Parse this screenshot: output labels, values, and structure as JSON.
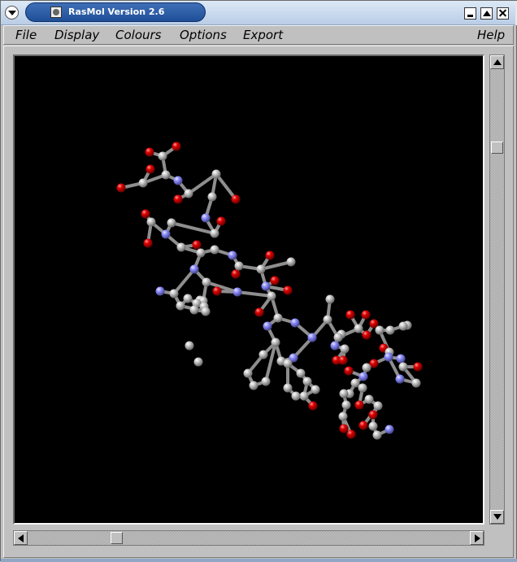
{
  "window": {
    "title": "RasMol Version 2.6"
  },
  "menu": {
    "file": "File",
    "display": "Display",
    "colours": "Colours",
    "options": "Options",
    "export": "Export",
    "help": "Help"
  },
  "scroll": {
    "vertical_fraction": 0.2,
    "horizontal_fraction": 0.21
  },
  "colors": {
    "carbon": "#a8a8a8",
    "oxygen": "#e00000",
    "nitrogen": "#8f8fff",
    "bond": "#a8a8a8",
    "background": "#000000"
  }
}
